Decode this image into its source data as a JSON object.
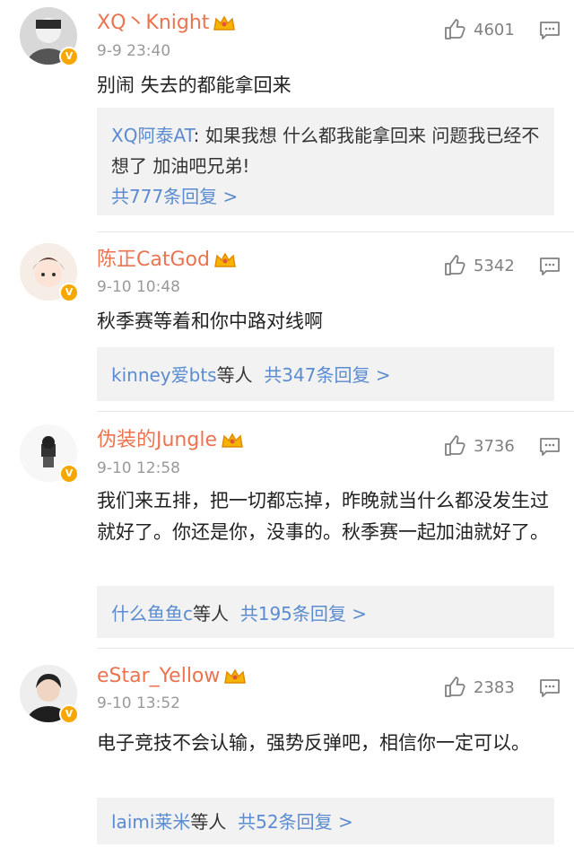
{
  "comments": [
    {
      "username": "XQ丶Knight",
      "time": "9-9 23:40",
      "likes": "4601",
      "text": "别闹  失去的都能拿回来",
      "reply_preview": {
        "author": "XQ阿泰AT",
        "text": ": 如果我想 什么都我能拿回来 问题我已经不想了 加油吧兄弟!",
        "more": "共777条回复 >"
      }
    },
    {
      "username": "陈正CatGod",
      "time": "9-10 10:48",
      "likes": "5342",
      "text": "秋季赛等着和你中路对线啊",
      "reply_summary": {
        "names": "kinney爱bts",
        "suffix": "等人",
        "more": "共347条回复 >"
      }
    },
    {
      "username": "伪装的Jungle",
      "time": "9-10 12:58",
      "likes": "3736",
      "text": "我们来五排，把一切都忘掉，昨晚就当什么都没发生过就好了。你还是你，没事的。秋季赛一起加油就好了。",
      "reply_summary": {
        "names": "什么鱼鱼c",
        "suffix": "等人",
        "more": "共195条回复 >"
      }
    },
    {
      "username": "eStar_Yellow",
      "time": "9-10 13:52",
      "likes": "2383",
      "text": "电子竞技不会认输，强势反弹吧，相信你一定可以。",
      "reply_summary": {
        "names": "laimi莱米",
        "suffix": "等人",
        "more": "共52条回复 >"
      }
    }
  ],
  "colors": {
    "username": "#eb7350",
    "link": "#5b8bd0",
    "badge": "#f7a800",
    "reply_bg": "#f2f2f2"
  },
  "icons": {
    "like": "thumbs-up-icon",
    "reply": "comment-bubble-icon",
    "crown": "vip-crown-icon",
    "verified": "verified-v-badge-icon"
  }
}
